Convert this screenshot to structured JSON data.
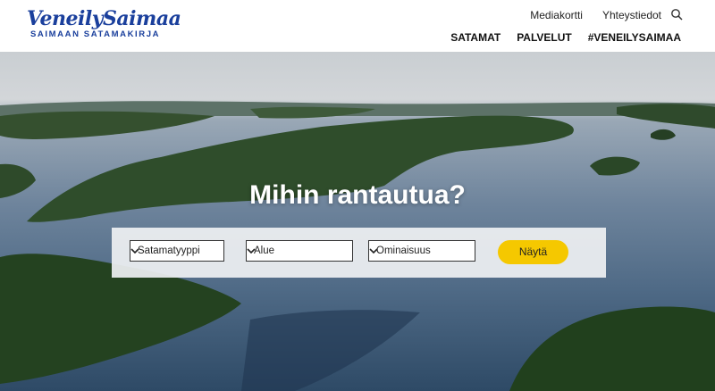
{
  "brand": {
    "logo_main": "VeneilySaimaa",
    "logo_sub": "SAIMAAN SATAMAKIRJA",
    "color": "#1a3f9c"
  },
  "top_links": [
    "Mediakortti",
    "Yhteystiedot"
  ],
  "main_nav": [
    "SATAMAT",
    "PALVELUT",
    "#VENEILYSAIMAA"
  ],
  "hero": {
    "title": "Mihin rantautua?"
  },
  "filters": {
    "harbor_type": "Satamatyyppi",
    "area": "Alue",
    "feature": "Ominaisuus",
    "submit_label": "Näytä",
    "button_color": "#f5c800"
  },
  "icons": {
    "search": "search-icon",
    "chevron": "chevron-down-icon"
  }
}
